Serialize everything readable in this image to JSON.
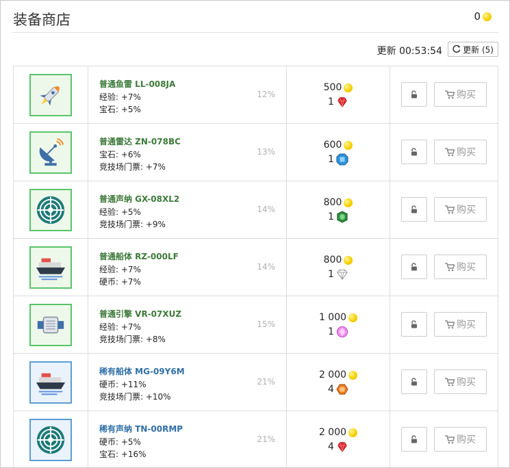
{
  "header": {
    "title": "装备商店",
    "coin_balance": "0"
  },
  "refresh": {
    "timer_label": "更新 00:53:54",
    "button_label": "更新 (5)"
  },
  "actions": {
    "buy_label": "购买"
  },
  "items": [
    {
      "name": "普通鱼雷 LL-008JA",
      "rarity": "common",
      "icon": "torpedo-icon",
      "stat1": "经验: +7%",
      "stat2": "宝石: +5%",
      "percent": "12%",
      "gold_price": "500",
      "gem_count": "1",
      "gem": "red-ruby-gem-icon"
    },
    {
      "name": "普通雷达 ZN-078BC",
      "rarity": "common",
      "icon": "radar-icon",
      "stat1": "宝石: +6%",
      "stat2": "竞技场门票: +7%",
      "percent": "13%",
      "gold_price": "600",
      "gem_count": "1",
      "gem": "blue-sapphire-gem-icon"
    },
    {
      "name": "普通声纳 GX-08XL2",
      "rarity": "common",
      "icon": "sonar-icon",
      "stat1": "经验: +5%",
      "stat2": "竞技场门票: +9%",
      "percent": "14%",
      "gold_price": "800",
      "gem_count": "1",
      "gem": "green-emerald-gem-icon"
    },
    {
      "name": "普通船体 RZ-000LF",
      "rarity": "common",
      "icon": "ship-hull-icon",
      "stat1": "经验: +7%",
      "stat2": "硬币: +7%",
      "percent": "14%",
      "gold_price": "800",
      "gem_count": "1",
      "gem": "white-diamond-gem-icon"
    },
    {
      "name": "普通引擎 VR-07XUZ",
      "rarity": "common",
      "icon": "engine-icon",
      "stat1": "经验: +7%",
      "stat2": "竞技场门票: +8%",
      "percent": "15%",
      "gold_price": "1 000",
      "gem_count": "1",
      "gem": "pink-gem-icon"
    },
    {
      "name": "稀有船体 MG-09Y6M",
      "rarity": "rare",
      "icon": "ship-hull-icon",
      "stat1": "硬币: +11%",
      "stat2": "竞技场门票: +10%",
      "percent": "21%",
      "gold_price": "2 000",
      "gem_count": "4",
      "gem": "orange-gem-icon"
    },
    {
      "name": "稀有声纳 TN-00RMP",
      "rarity": "rare",
      "icon": "sonar-icon",
      "stat1": "硬币: +5%",
      "stat2": "宝石: +16%",
      "percent": "21%",
      "gold_price": "2 000",
      "gem_count": "4",
      "gem": "red-ruby-gem-icon"
    }
  ],
  "colors": {
    "common": "#3d7a3a",
    "rare": "#2f6fa7",
    "gold": "#f7d100"
  }
}
